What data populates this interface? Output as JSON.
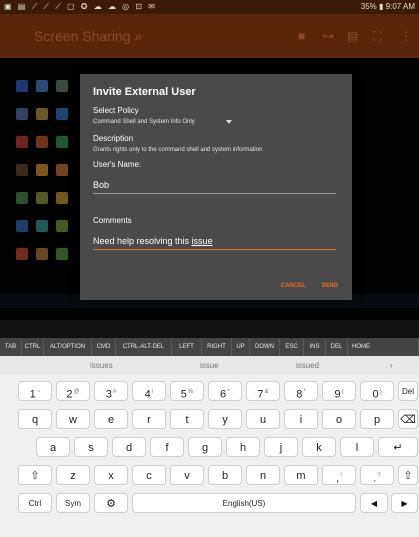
{
  "status": {
    "icons_left": "▣ ▤ ⟋ ⟋ ⟋ ▢ ✪ ☁ ☁ ◎ ⊡ ✉",
    "battery": "35%",
    "time": "9:07 AM"
  },
  "appbar": {
    "title": "Screen Sharing »",
    "icons": [
      "square-icon",
      "key-icon",
      "keyboard-icon",
      "fullscreen-icon",
      "more-icon"
    ]
  },
  "dialog": {
    "title": "Invite External User",
    "policy_label": "Select Policy",
    "policy_value": "Command Shell and System Info Only",
    "description_label": "Description",
    "description_text": "Grants rights only to the command shell and system information",
    "name_label": "User's Name:",
    "name_value": "Bob",
    "comments_label": "Comments",
    "comments_value_prefix": "Need help resolving this ",
    "comments_value_word": "issue",
    "cancel_label": "CANCEL",
    "send_label": "SEND"
  },
  "keybar": [
    "TAB",
    "CTRL",
    "ALT/OPTION",
    "CMD",
    "CTRL-ALT-DEL",
    "LEFT",
    "RIGHT",
    "UP",
    "DOWN",
    "ESC",
    "INS",
    "DEL",
    "HOME"
  ],
  "suggestions": [
    "issues",
    "issue",
    "issued",
    "›"
  ],
  "keyboard": {
    "row1": [
      [
        "1",
        "~"
      ],
      [
        "2",
        "@"
      ],
      [
        "3",
        "#"
      ],
      [
        "4",
        "/"
      ],
      [
        "5",
        "%"
      ],
      [
        "6",
        "^"
      ],
      [
        "7",
        "&"
      ],
      [
        "8",
        "*"
      ],
      [
        "9",
        "("
      ],
      [
        "0",
        ")"
      ],
      [
        "Del",
        ""
      ]
    ],
    "row2": [
      "q",
      "w",
      "e",
      "r",
      "t",
      "y",
      "u",
      "i",
      "o",
      "p",
      "⌫"
    ],
    "row3": [
      "a",
      "s",
      "d",
      "f",
      "g",
      "h",
      "j",
      "k",
      "l",
      "↵"
    ],
    "row4": [
      "⇧",
      "z",
      "x",
      "c",
      "v",
      "b",
      "n",
      "m",
      ",",
      ".",
      "⇧"
    ],
    "row4_sup": [
      "",
      "",
      "",
      "",
      "",
      "",
      "",
      "",
      "!",
      "?",
      ""
    ],
    "row5": [
      "Ctrl",
      "Sym",
      "⚙",
      "English(US)",
      "◀",
      "▶"
    ]
  }
}
